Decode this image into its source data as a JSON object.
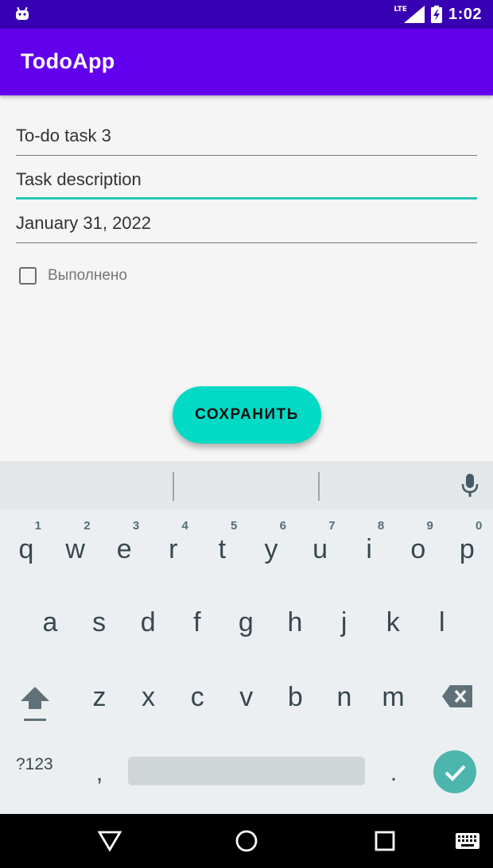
{
  "status_bar": {
    "network": "LTE",
    "time": "1:02"
  },
  "app_bar": {
    "title": "TodoApp"
  },
  "form": {
    "title_value": "To-do task 3",
    "description_placeholder": "Task description",
    "date_value": "January 31, 2022",
    "done_label": "Выполнено",
    "done_checked": false,
    "save_label": "СОХРАНИТЬ"
  },
  "keyboard": {
    "row1": [
      {
        "key": "q",
        "hint": "1"
      },
      {
        "key": "w",
        "hint": "2"
      },
      {
        "key": "e",
        "hint": "3"
      },
      {
        "key": "r",
        "hint": "4"
      },
      {
        "key": "t",
        "hint": "5"
      },
      {
        "key": "y",
        "hint": "6"
      },
      {
        "key": "u",
        "hint": "7"
      },
      {
        "key": "i",
        "hint": "8"
      },
      {
        "key": "o",
        "hint": "9"
      },
      {
        "key": "p",
        "hint": "0"
      }
    ],
    "row2": [
      "a",
      "s",
      "d",
      "f",
      "g",
      "h",
      "j",
      "k",
      "l"
    ],
    "row3": [
      "z",
      "x",
      "c",
      "v",
      "b",
      "n",
      "m"
    ],
    "symbols_label": "?123",
    "comma": ",",
    "period": "."
  },
  "colors": {
    "status_bar": "#3700b3",
    "app_bar": "#6200ee",
    "accent": "#03dac5",
    "focus_line": "#26c6b8",
    "enter_key": "#4db6ac"
  }
}
